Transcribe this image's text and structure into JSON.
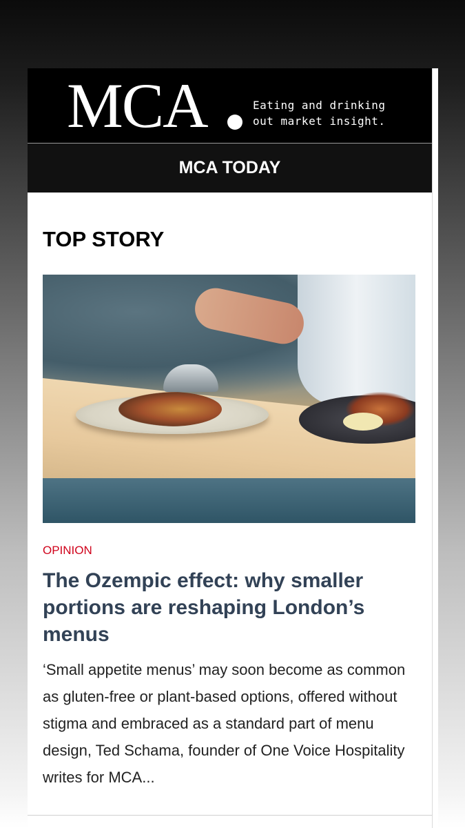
{
  "header": {
    "logo_text": "MCA",
    "tagline": "Eating and drinking\nout market insight."
  },
  "nav": {
    "title": "MCA TODAY"
  },
  "main": {
    "section_heading": "TOP STORY",
    "hero_image": {
      "icon": "plated-dishes-photo"
    },
    "article": {
      "category": "OPINION",
      "headline": "The Ozempic effect: why smaller portions are reshaping London’s menus",
      "summary": "‘Small appetite menus’ may soon become as common as gluten-free or plant-based options, offered without stigma and embraced as a standard part of menu design, Ted Schama, founder of One Voice Hospitality writes for MCA..."
    }
  },
  "colors": {
    "category_accent": "#d0021b",
    "headline": "#324256",
    "masthead_bg": "#000000",
    "nav_bg": "#111111"
  }
}
